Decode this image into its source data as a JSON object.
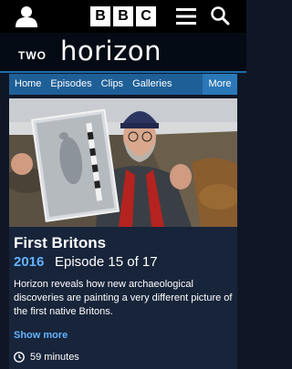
{
  "topbar": {
    "logo_letters": [
      "B",
      "B",
      "C"
    ],
    "account_icon": "user-icon",
    "menu_icon": "hamburger-icon",
    "search_icon": "search-icon"
  },
  "banner": {
    "channel": "TWO",
    "title": "horizon"
  },
  "nav": {
    "items": [
      "Home",
      "Episodes",
      "Clips",
      "Galleries"
    ],
    "more": "More"
  },
  "programme": {
    "title": "First Britons",
    "year": "2016",
    "episode": "Episode 15 of 17",
    "description": "Horizon reveals how new archaeological discoveries are painting a very different picture of the first native Britons.",
    "show_more": "Show more",
    "duration": "59 minutes"
  },
  "colors": {
    "page_bg": "#0f1726",
    "nav_bg": "#1f5f97",
    "accent_blue": "#63b3ff",
    "card_bg": "#17243a"
  }
}
